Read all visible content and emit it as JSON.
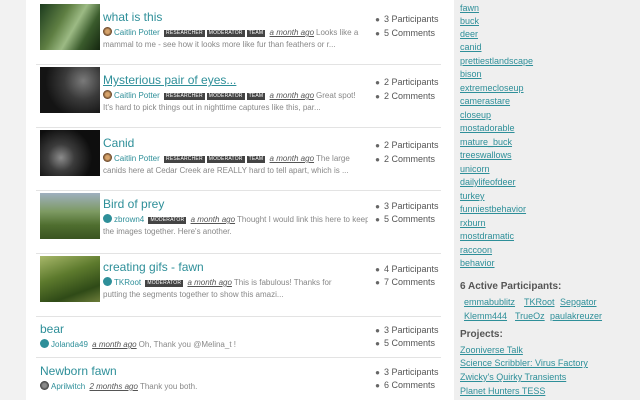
{
  "threads": [
    {
      "title": "what is this",
      "author": "Caitlin Potter",
      "badges": [
        "RESEARCHER",
        "MODERATOR",
        "TEAM"
      ],
      "time": "a month ago",
      "excerpt1": "Looks like a",
      "excerpt2": "mammal to me - see how it looks more like fur than feathers or r...",
      "participants": "3 Participants",
      "comments": "5 Comments"
    },
    {
      "title": "Mysterious pair of eyes...",
      "author": "Caitlin Potter",
      "badges": [
        "RESEARCHER",
        "MODERATOR",
        "TEAM"
      ],
      "time": "a month ago",
      "excerpt1": "Great spot!",
      "excerpt2": "It's hard to pick things out in nighttime captures like this, par...",
      "participants": "2 Participants",
      "comments": "2 Comments"
    },
    {
      "title": "Canid",
      "author": "Caitlin Potter",
      "badges": [
        "RESEARCHER",
        "MODERATOR",
        "TEAM"
      ],
      "time": "a month ago",
      "excerpt1": "The large",
      "excerpt2": "canids here at Cedar Creek are REALLY hard to tell apart, which is ...",
      "participants": "2 Participants",
      "comments": "2 Comments"
    },
    {
      "title": "Bird of prey",
      "author": "zbrown4",
      "badges": [
        "MODERATOR"
      ],
      "time": "a month ago",
      "excerpt1": "Thought I would link this here to keep",
      "excerpt2": "the images together. Here's another.",
      "participants": "3 Participants",
      "comments": "5 Comments"
    },
    {
      "title": "creating gifs - fawn",
      "author": "TKRoot",
      "badges": [
        "MODERATOR"
      ],
      "time": "a month ago",
      "excerpt1": "This is fabulous! Thanks for",
      "excerpt2": "putting the segments together to show this amazi...",
      "participants": "4 Participants",
      "comments": "7 Comments"
    },
    {
      "title": "bear",
      "author": "Jolanda49",
      "badges": [],
      "time": "a month ago",
      "excerpt1": "Oh, Thank you @Melina_t !",
      "excerpt2": "",
      "participants": "3 Participants",
      "comments": "5 Comments"
    },
    {
      "title": "Newborn fawn",
      "author": "Aprilwitch",
      "badges": [],
      "time": "2 months ago",
      "excerpt1": "Thank you both.",
      "excerpt2": "",
      "participants": "3 Participants",
      "comments": "6 Comments"
    }
  ],
  "tags": [
    "fawn",
    "buck",
    "deer",
    "canid",
    "prettiestlandscape",
    "bison",
    "extremecloseup",
    "camerastare",
    "closeup",
    "mostadorable",
    "mature_buck",
    "treeswallows",
    "unicorn",
    "dailylifeofdeer",
    "turkey",
    "funniestbehavior",
    "rxburn",
    "mostdramatic",
    "raccoon",
    "behavior"
  ],
  "participants_heading": "6 Active Participants:",
  "participants": [
    "emmabublitz",
    "TKRoot",
    "Sepgator",
    "Klemm444",
    "TrueOz",
    "paulakreuzer"
  ],
  "projects_heading": "Projects:",
  "projects": [
    "Zooniverse Talk",
    "Science Scribbler: Virus Factory",
    "Zwicky's Quirky Transients",
    "Planet Hunters TESS"
  ],
  "icons": {
    "participants": "user-icon",
    "comments": "comment-icon"
  },
  "colors": {
    "link": "#2e8f99",
    "sidebar_bg": "#efefef"
  }
}
